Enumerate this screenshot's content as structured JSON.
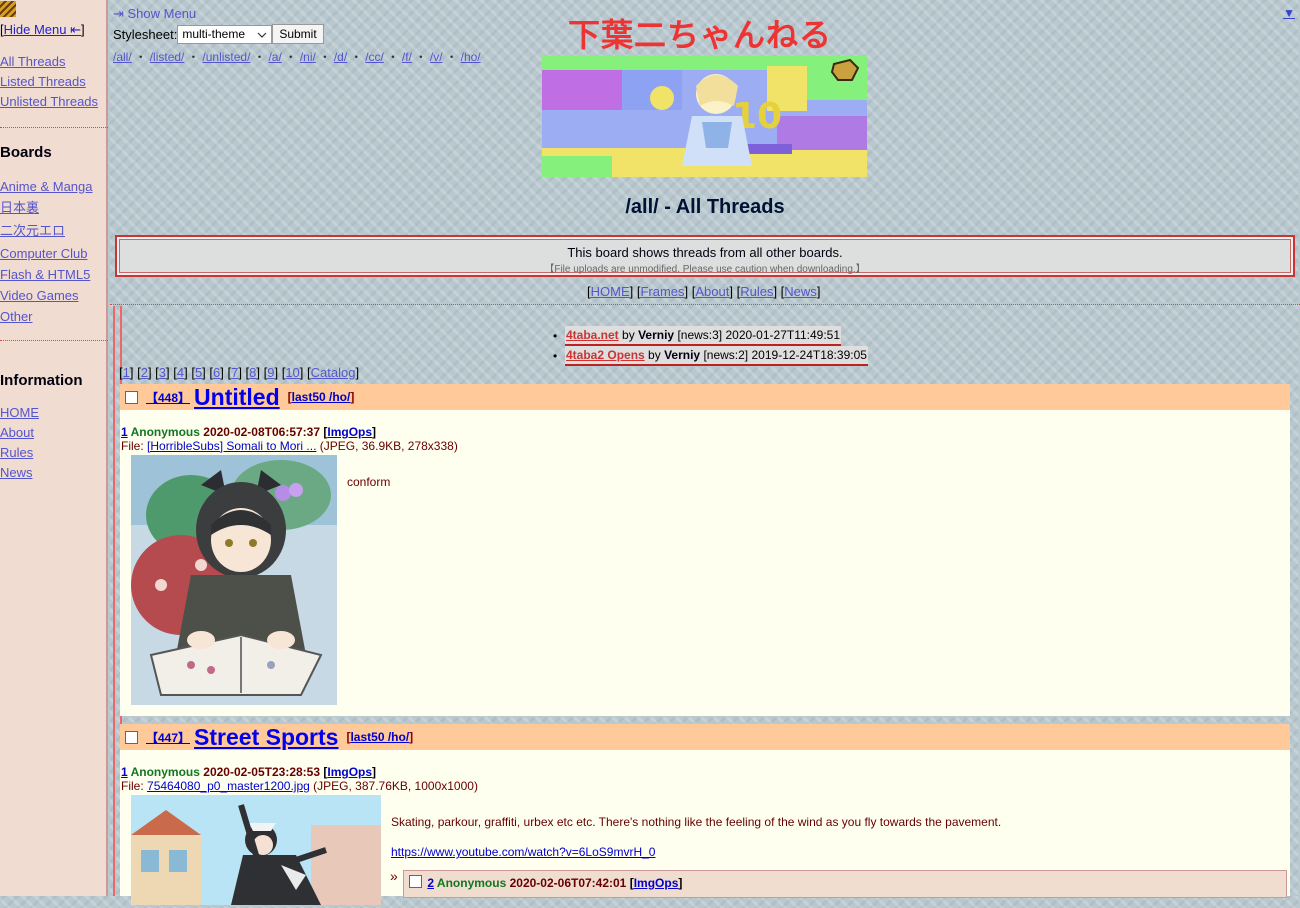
{
  "sidebar": {
    "hide_menu_prefix": "[",
    "hide_menu_label": "Hide Menu ⇤",
    "hide_menu_suffix": "]",
    "top_links": [
      "All Threads",
      "Listed Threads",
      "Unlisted Threads"
    ],
    "boards_heading": "Boards",
    "boards": [
      "Anime & Manga",
      "日本裏",
      "二次元エロ",
      "Computer Club",
      "Flash & HTML5",
      "Video Games",
      "Other"
    ],
    "info_heading": "Information",
    "info_links": [
      "HOME",
      "About",
      "Rules",
      "News"
    ]
  },
  "topbar": {
    "show_menu": "⇥ Show Menu",
    "stylesheet_label": "Stylesheet:",
    "stylesheet_value": "multi-theme",
    "submit_label": "Submit",
    "board_links": [
      "/all/",
      "/listed/",
      "/unlisted/",
      "/a/",
      "/ni/",
      "/d/",
      "/cc/",
      "/f/",
      "/v/",
      "/ho/"
    ],
    "corner_arrow": "▼"
  },
  "header": {
    "site_title": "下葉二ちゃんねる",
    "board_title": "/all/ - All Threads",
    "notice_main": "This board shows threads from all other boards.",
    "notice_sub": "【File uploads are unmodified. Please use caution when downloading.】",
    "nav_links": [
      "HOME",
      "Frames",
      "About",
      "Rules",
      "News"
    ]
  },
  "news": [
    {
      "title": "4taba.net",
      "by": "by",
      "author": "Verniy",
      "tag": "[news:3]",
      "date": "2020-01-27T11:49:51"
    },
    {
      "title": "4taba2 Opens",
      "by": "by",
      "author": "Verniy",
      "tag": "[news:2]",
      "date": "2019-12-24T18:39:05"
    }
  ],
  "pager": {
    "pages": [
      "1",
      "2",
      "3",
      "4",
      "5",
      "6",
      "7",
      "8",
      "9",
      "10"
    ],
    "catalog": "Catalog"
  },
  "threads": [
    {
      "num": "【448】",
      "title": "Untitled",
      "last50": "last50 /ho/",
      "post": {
        "no": "1",
        "name": "Anonymous",
        "date": "2020-02-08T06:57:37",
        "imgops": "ImgOps",
        "file_prefix": "File: ",
        "file_name": "[HorribleSubs] Somali to Mori ...",
        "file_info": "(JPEG, 36.9KB, 278x338)",
        "message": "conform"
      }
    },
    {
      "num": "【447】",
      "title": "Street Sports",
      "last50": "last50 /ho/",
      "post": {
        "no": "1",
        "name": "Anonymous",
        "date": "2020-02-05T23:28:53",
        "imgops": "ImgOps",
        "file_prefix": "File: ",
        "file_name": "75464080_p0_master1200.jpg",
        "file_info": "(JPEG, 387.76KB, 1000x1000)",
        "message": "Skating, parkour, graffiti, urbex etc etc. There's nothing like the feeling of the wind as you fly towards the pavement.",
        "link": "https://www.youtube.com/watch?v=6LoS9mvrH_0"
      },
      "reply": {
        "arrow": "»",
        "no": "2",
        "name": "Anonymous",
        "date": "2020-02-06T07:42:01",
        "imgops": "ImgOps"
      }
    }
  ]
}
